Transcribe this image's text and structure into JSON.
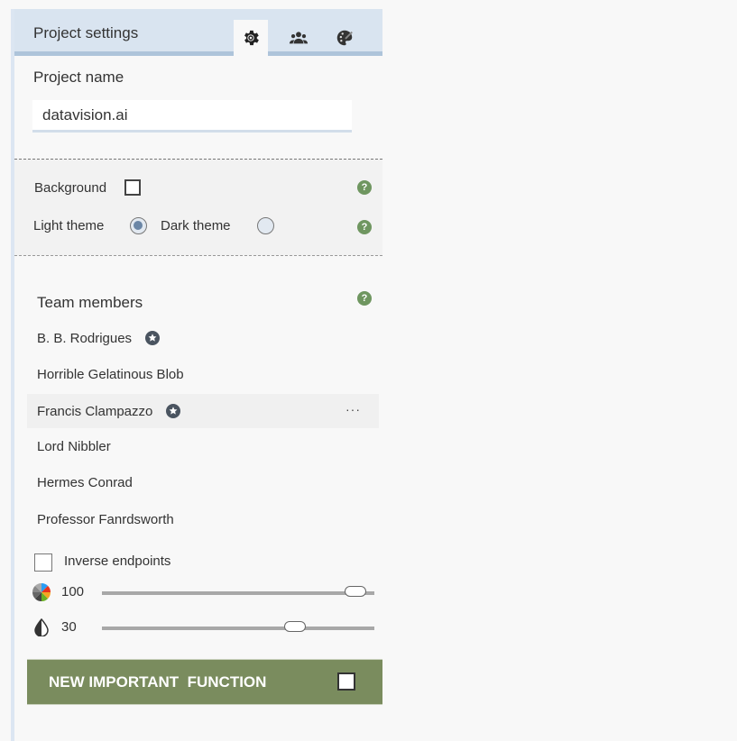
{
  "header": {
    "title": "Project settings",
    "tabs": [
      {
        "icon": "gear-icon",
        "active": true
      },
      {
        "icon": "team-icon",
        "active": false
      },
      {
        "icon": "palette-icon",
        "active": false
      }
    ]
  },
  "project": {
    "label": "Project name",
    "value": "datavision.ai"
  },
  "options": {
    "background_label": "Background",
    "background_checked": false,
    "light_theme_label": "Light theme",
    "dark_theme_label": "Dark theme",
    "selected_theme": "light",
    "help_glyph": "?"
  },
  "team": {
    "title": "Team members",
    "members": [
      {
        "name": "B. B. Rodrigues",
        "starred": true
      },
      {
        "name": "Horrible Gelatinous Blob",
        "starred": false
      },
      {
        "name": "Francis Clampazzo",
        "starred": true,
        "hovered": true,
        "more": "···"
      },
      {
        "name": "Lord Nibbler",
        "starred": false
      },
      {
        "name": "Hermes Conrad",
        "starred": false
      },
      {
        "name": "Professor Fanrdsworth",
        "starred": false
      }
    ]
  },
  "inverse_endpoints": {
    "label": "Inverse endpoints",
    "checked": false
  },
  "sliders": [
    {
      "icon": "color-wheel-icon",
      "value": "100",
      "position": 0.93
    },
    {
      "icon": "opacity-drop-icon",
      "value": "30",
      "position": 0.71
    }
  ],
  "cta": {
    "label": "NEW IMPORTANT  FUNCTION",
    "checked": false,
    "color": "#7a8c5e"
  },
  "colors": {
    "accent_help": "#6f9660",
    "header_bg": "#d9e4f0",
    "radio_fill": "#6a86a6"
  }
}
